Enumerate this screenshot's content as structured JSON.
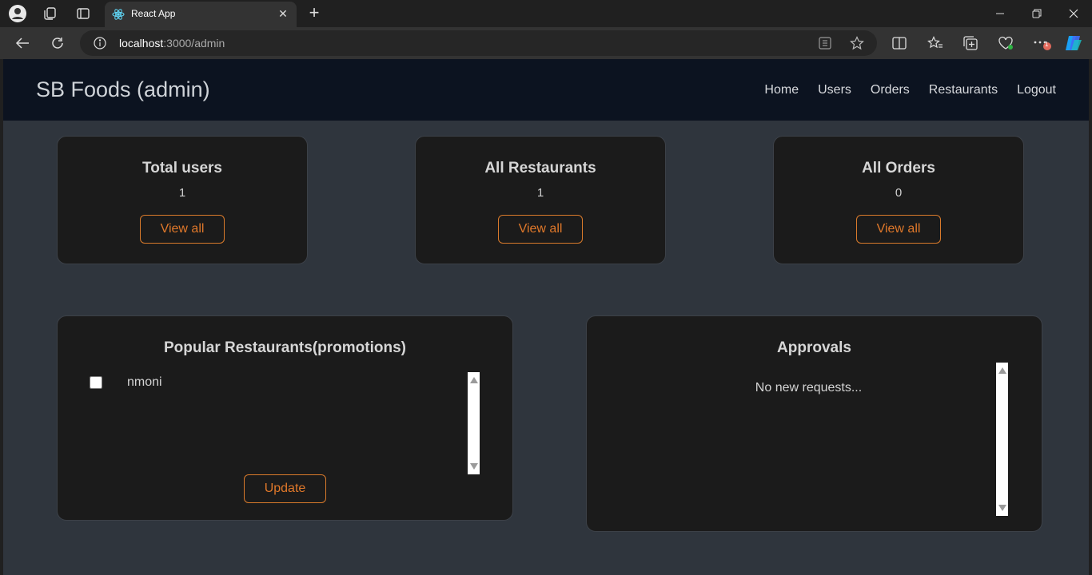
{
  "browser": {
    "tab_title": "React App",
    "url_host": "localhost",
    "url_rest": ":3000/admin",
    "notification_count": "1"
  },
  "navbar": {
    "brand": "SB Foods (admin)",
    "links": [
      "Home",
      "Users",
      "Orders",
      "Restaurants",
      "Logout"
    ]
  },
  "stats": [
    {
      "title": "Total users",
      "count": "1",
      "button": "View all"
    },
    {
      "title": "All Restaurants",
      "count": "1",
      "button": "View all"
    },
    {
      "title": "All Orders",
      "count": "0",
      "button": "View all"
    }
  ],
  "promotions": {
    "title": "Popular Restaurants(promotions)",
    "items": [
      {
        "name": "nmoni",
        "checked": false
      }
    ],
    "button": "Update"
  },
  "approvals": {
    "title": "Approvals",
    "empty_text": "No new requests..."
  },
  "colors": {
    "accent": "#e0782a",
    "page_bg": "#2f353d",
    "navbar_bg": "#0c1320",
    "card_bg": "#1b1b1b"
  }
}
